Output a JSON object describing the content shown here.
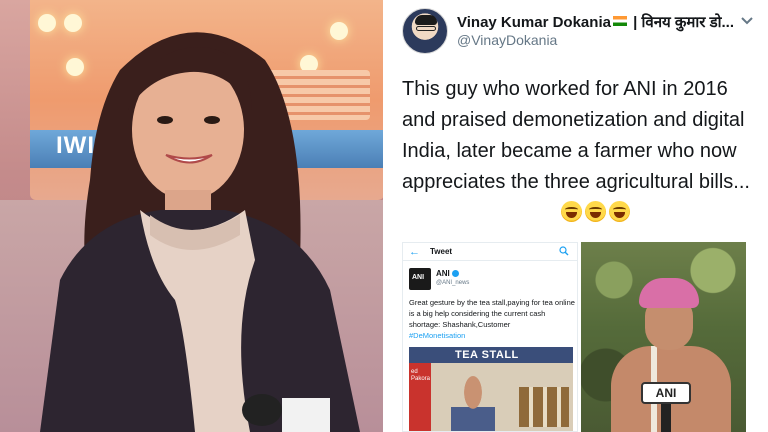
{
  "tweet": {
    "display_name": "Vinay Kumar Dokania",
    "display_name_suffix": " | विनय कुमार डो...",
    "handle": "@VinayDokania",
    "text": "This guy who worked for ANI in 2016 and praised demonetization and digital India, later became a farmer who now appreciates the three agricultural bills...",
    "emojis": [
      "face-with-tears-of-joy",
      "rolling-on-floor-laughing",
      "grinning-sweat"
    ],
    "flag_icon": "india-flag-icon",
    "menu_icon": "chevron-down-icon"
  },
  "left_photo": {
    "background_text": "IWI",
    "subject": "woman-with-microphone"
  },
  "embedded_tweet": {
    "header_title": "Tweet",
    "back_icon": "back-arrow-icon",
    "search_icon": "search-icon",
    "avatar_text": "ANI",
    "name": "ANI",
    "handle": "@ANI_news",
    "text": "Great gesture by the tea stall,paying for tea online is a big help considering the current cash shortage: Shashank,Customer",
    "hashtag": "#DeMonetisation",
    "photo_sign": "TEA STALL",
    "photo_side_text": "ed\nPakora"
  },
  "farmer_photo": {
    "mic_label": "ANI"
  }
}
